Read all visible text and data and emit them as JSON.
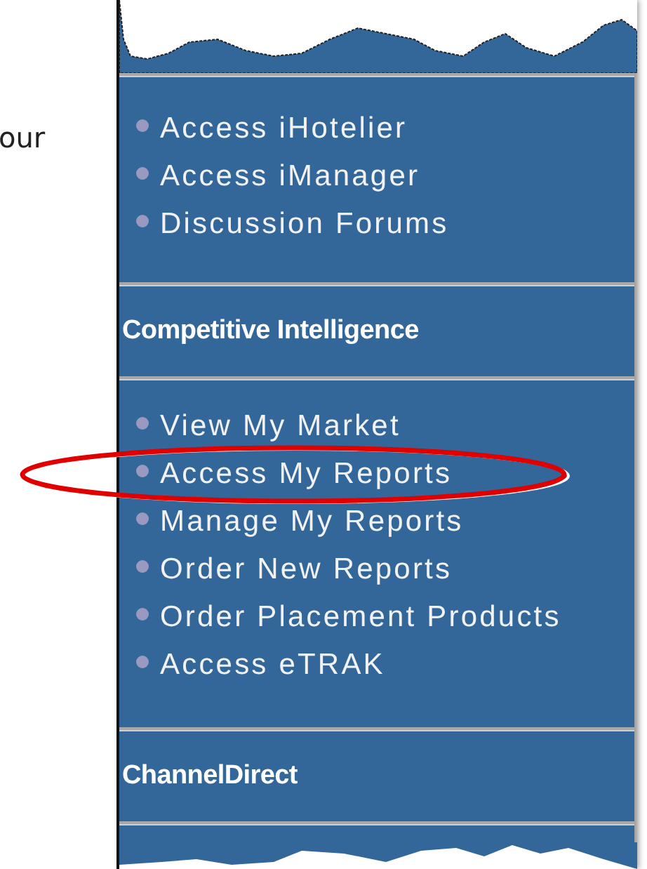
{
  "side_text": "our",
  "sections": [
    {
      "kind": "links",
      "items": [
        {
          "label": "Access iHotelier",
          "circled": false
        },
        {
          "label": "Access iManager",
          "circled": false
        },
        {
          "label": "Discussion Forums",
          "circled": false
        }
      ]
    },
    {
      "kind": "heading",
      "title": "Competitive Intelligence"
    },
    {
      "kind": "links",
      "items": [
        {
          "label": "View My Market",
          "circled": false
        },
        {
          "label": "Access My Reports",
          "circled": true
        },
        {
          "label": "Manage My Reports",
          "circled": false
        },
        {
          "label": "Order New Reports",
          "circled": false
        },
        {
          "label": "Order Placement Products",
          "circled": false
        },
        {
          "label": "Access eTRAK",
          "circled": false
        }
      ]
    },
    {
      "kind": "heading",
      "title": "ChannelDirect"
    }
  ]
}
